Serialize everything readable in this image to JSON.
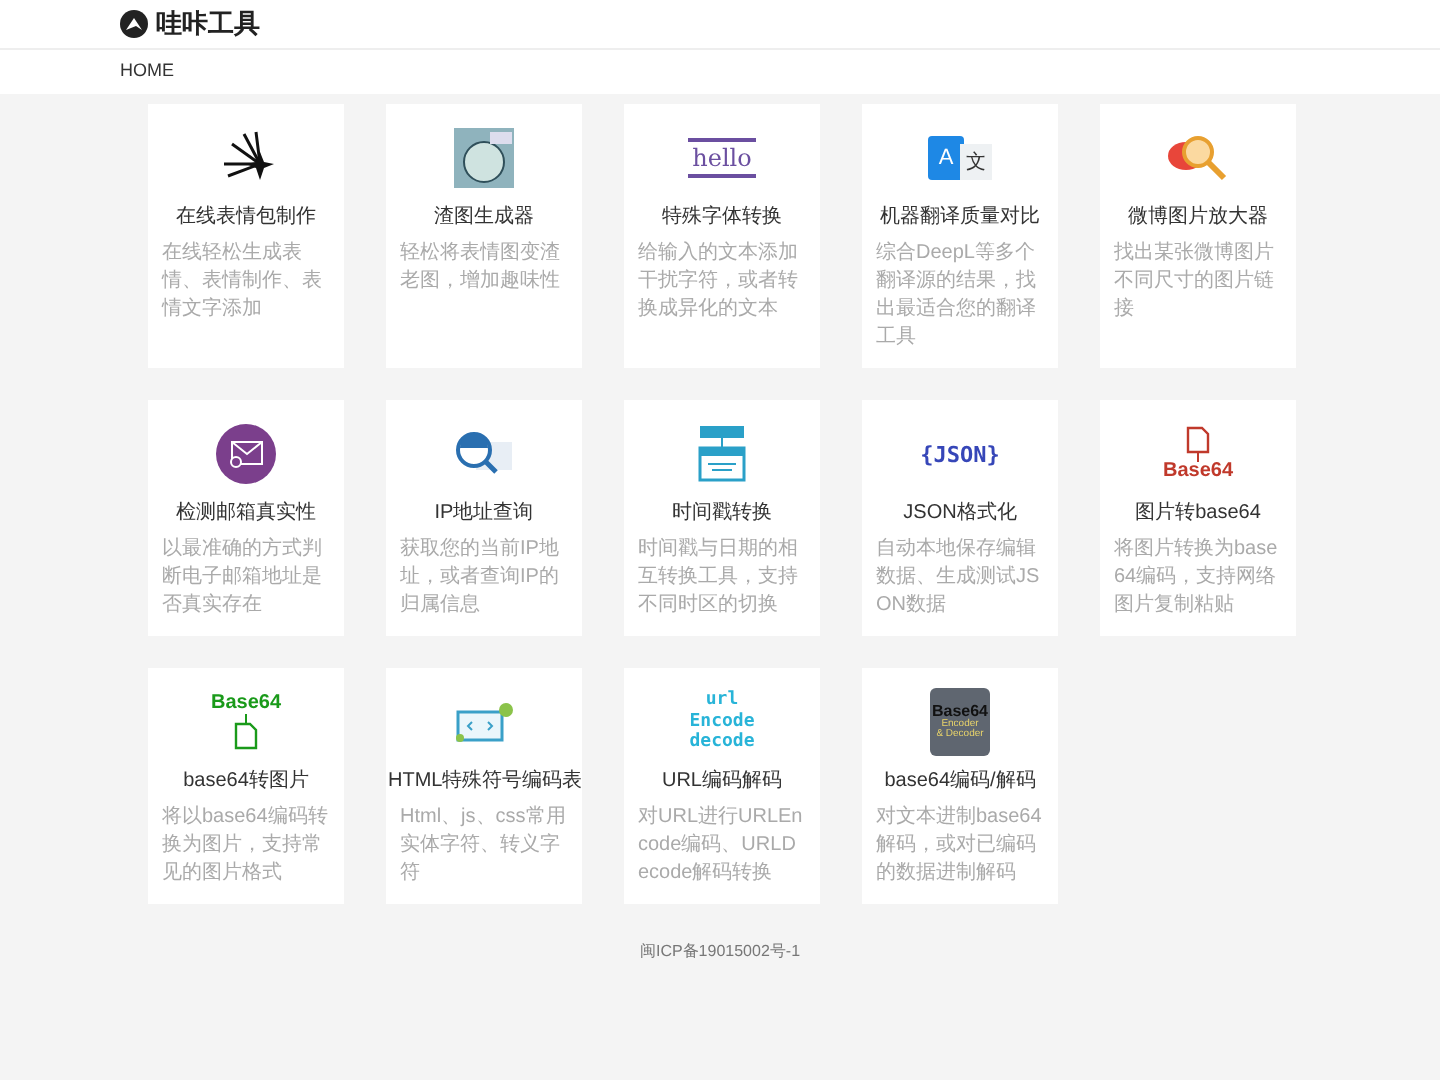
{
  "header": {
    "logo_text": "哇咔工具"
  },
  "nav": {
    "items": [
      {
        "label": "HOME"
      }
    ]
  },
  "tools": [
    {
      "title": "在线表情包制作",
      "description": "在线轻松生成表情、表情制作、表情文字添加",
      "kind": "sparkle"
    },
    {
      "title": "渣图生成器",
      "description": "轻松将表情图变渣老图，增加趣味性",
      "kind": "meme"
    },
    {
      "title": "特殊字体转换",
      "description": "给输入的文本添加干扰字符，或者转换成异化的文本",
      "kind": "hello",
      "icon_text": [
        "hello"
      ]
    },
    {
      "title": "机器翻译质量对比",
      "description": "综合DeepL等多个翻译源的结果，找出最适合您的翻译工具",
      "kind": "translate",
      "icon_text": [
        "A",
        "文"
      ]
    },
    {
      "title": "微博图片放大器",
      "description": "找出某张微博图片不同尺寸的图片链接",
      "kind": "weibo"
    },
    {
      "title": "检测邮箱真实性",
      "description": "以最准确的方式判断电子邮箱地址是否真实存在",
      "kind": "mail"
    },
    {
      "title": "IP地址查询",
      "description": "获取您的当前IP地址，或者查询IP的归属信息",
      "kind": "ip"
    },
    {
      "title": "时间戳转换",
      "description": "时间戳与日期的相互转换工具，支持不同时区的切换",
      "kind": "timestamp"
    },
    {
      "title": "JSON格式化",
      "description": "自动本地保存编辑数据、生成测试JSON数据",
      "kind": "json",
      "icon_text": [
        "{JSON}"
      ]
    },
    {
      "title": "图片转base64",
      "description": "将图片转换为base64编码，支持网络图片复制粘贴",
      "kind": "img2b64",
      "icon_text": [
        "Base64"
      ]
    },
    {
      "title": "base64转图片",
      "description": "将以base64编码转换为图片，支持常见的图片格式",
      "kind": "b642img",
      "icon_text": [
        "Base64"
      ]
    },
    {
      "title": "HTML特殊符号编码表",
      "description": "Html、js、css常用实体字符、转义字符",
      "kind": "html"
    },
    {
      "title": "URL编码解码",
      "description": "对URL进行URLEncode编码、URLDecode解码转换",
      "kind": "url",
      "icon_text": [
        "url",
        "Encode",
        "decode"
      ]
    },
    {
      "title": "base64编码/解码",
      "description": "对文本进制base64解码，或对已编码的数据进制解码",
      "kind": "b64codec",
      "icon_text": [
        "Base64",
        "Encoder",
        "& Decoder"
      ]
    }
  ],
  "footer": {
    "text": "闽ICP备19015002号-1"
  }
}
